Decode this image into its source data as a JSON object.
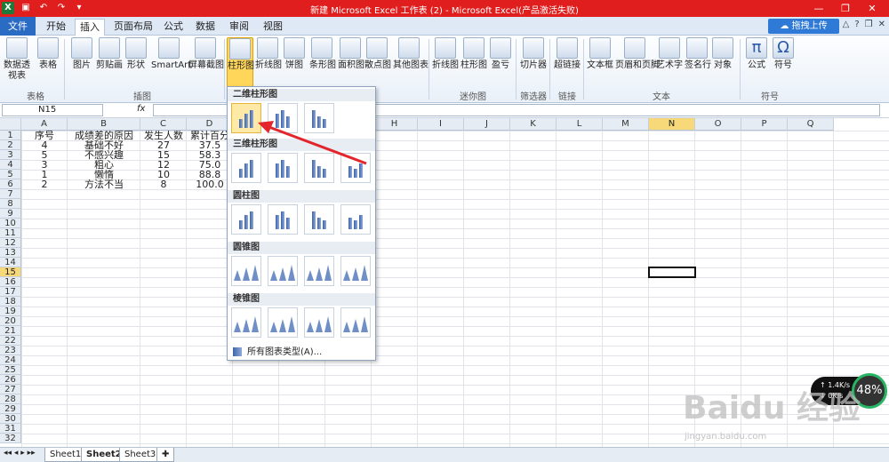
{
  "window": {
    "title": "新建 Microsoft Excel 工作表 (2) - Microsoft Excel(产品激活失败)",
    "app_icon": "X"
  },
  "tabs": [
    "文件",
    "开始",
    "插入",
    "页面布局",
    "公式",
    "数据",
    "审阅",
    "视图"
  ],
  "active_tab": "插入",
  "upload_button": "拖拽上传",
  "ribbon": {
    "buttons": [
      "数据透视表",
      "表格",
      "图片",
      "剪贴画",
      "形状",
      "SmartArt",
      "屏幕截图",
      "柱形图",
      "折线图",
      "饼图",
      "条形图",
      "面积图",
      "散点图",
      "其他图表",
      "折线图",
      "柱形图",
      "盈亏",
      "切片器",
      "超链接",
      "文本框",
      "页眉和页脚",
      "艺术字",
      "签名行",
      "对象",
      "公式",
      "符号"
    ],
    "groups": [
      "表格",
      "插图",
      "迷你图",
      "筛选器",
      "链接",
      "文本",
      "符号"
    ]
  },
  "formula_bar": {
    "name_box": "N15",
    "fx": "fx",
    "value": ""
  },
  "columns": [
    "A",
    "B",
    "C",
    "D",
    "E",
    "F",
    "G",
    "H",
    "I",
    "J",
    "K",
    "L",
    "M",
    "N",
    "O",
    "P",
    "Q"
  ],
  "selected_column": "N",
  "selected_row": "15",
  "rows": [
    "1",
    "2",
    "3",
    "4",
    "5",
    "6",
    "7",
    "8",
    "9",
    "10",
    "11",
    "12",
    "13",
    "14",
    "15",
    "16",
    "17",
    "18",
    "19",
    "20",
    "21",
    "22",
    "23",
    "24",
    "25",
    "26",
    "27",
    "28",
    "29",
    "30",
    "31",
    "32"
  ],
  "table": {
    "headers": [
      "序号",
      "成绩差的原因",
      "发生人数",
      "累计百分"
    ],
    "data": [
      [
        "4",
        "基础不好",
        "27",
        "37.5"
      ],
      [
        "5",
        "不感兴趣",
        "15",
        "58.3"
      ],
      [
        "3",
        "粗心",
        "12",
        "75.0"
      ],
      [
        "1",
        "懒惰",
        "10",
        "88.8"
      ],
      [
        "2",
        "方法不当",
        "8",
        "100.0"
      ]
    ]
  },
  "dropdown": {
    "sections": [
      "二维柱形图",
      "三维柱形图",
      "圆柱图",
      "圆锥图",
      "棱锥图"
    ],
    "all_charts": "所有图表类型(A)..."
  },
  "sheets": [
    "Sheet1",
    "Sheet2",
    "Sheet3"
  ],
  "speed_widget": {
    "up": "1.4K/s",
    "down": "0K/s",
    "percent": "48%"
  },
  "watermark": {
    "main": "Baidu 经验",
    "sub": "jingyan.baidu.com"
  }
}
